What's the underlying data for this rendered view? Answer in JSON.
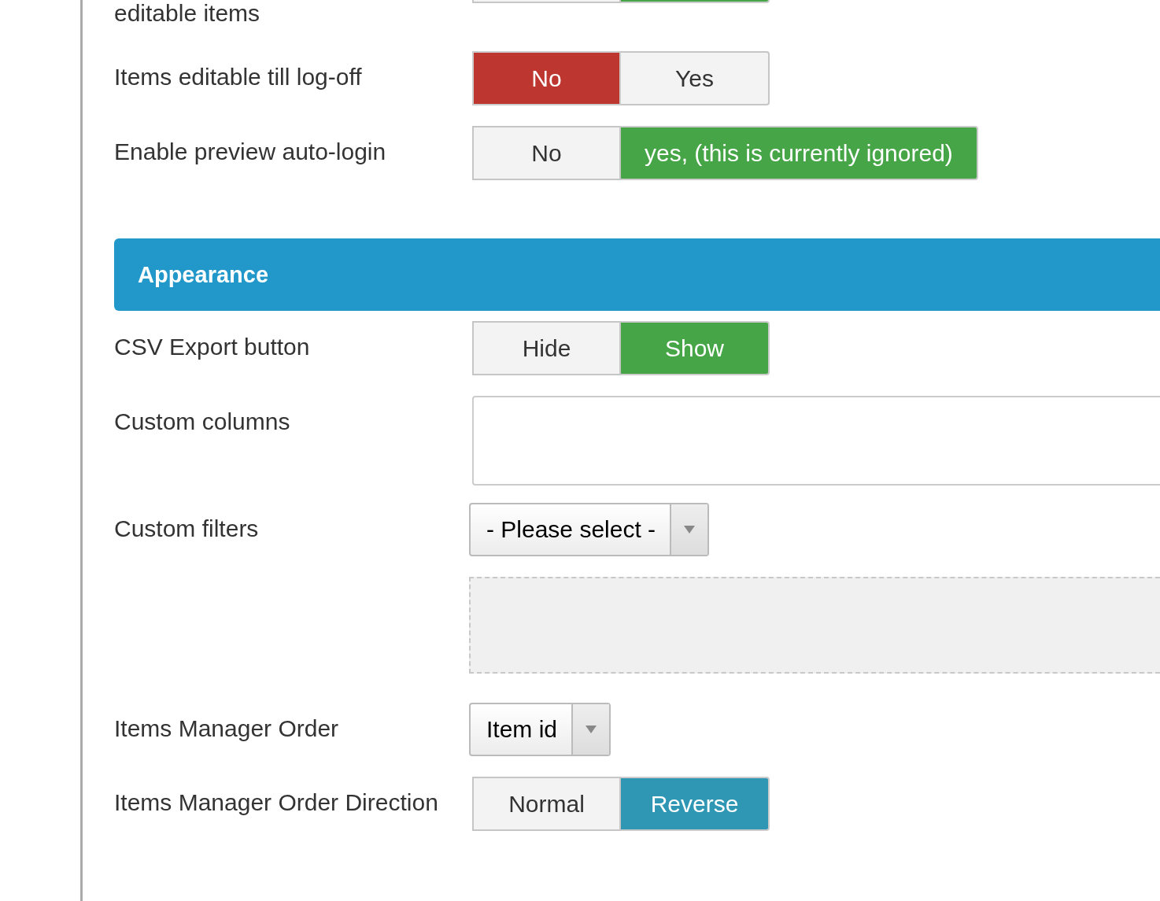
{
  "rows": [
    {
      "kind": "clipped-toggle",
      "label": "editable items",
      "color": "#46a546",
      "options": [
        {
          "selected": false
        },
        {
          "selected": true
        }
      ]
    },
    {
      "kind": "toggle",
      "label": "Items editable till log-off",
      "color": "#bd362f",
      "options": [
        {
          "label": "No",
          "selected": true
        },
        {
          "label": "Yes",
          "selected": false
        }
      ]
    },
    {
      "kind": "toggle",
      "label": "Enable preview auto-login",
      "color": "#46a546",
      "options": [
        {
          "label": "No",
          "selected": false
        },
        {
          "label": "yes, (this is currently ignored)",
          "selected": true
        }
      ]
    },
    {
      "kind": "header",
      "label": "Appearance"
    },
    {
      "kind": "toggle",
      "label": "CSV Export button",
      "color": "#46a546",
      "options": [
        {
          "label": "Hide",
          "selected": false
        },
        {
          "label": "Show",
          "selected": true
        }
      ]
    },
    {
      "kind": "textarea",
      "label": "Custom columns"
    },
    {
      "kind": "select",
      "label": "Custom filters",
      "value": "- Please select -"
    },
    {
      "kind": "dropzone"
    },
    {
      "kind": "select",
      "label": "Items Manager Order",
      "value": "Item id"
    },
    {
      "kind": "toggle",
      "label": "Items Manager Order Direction",
      "color": "#2f96b4",
      "options": [
        {
          "label": "Normal",
          "selected": false
        },
        {
          "label": "Reverse",
          "selected": true
        }
      ]
    }
  ]
}
